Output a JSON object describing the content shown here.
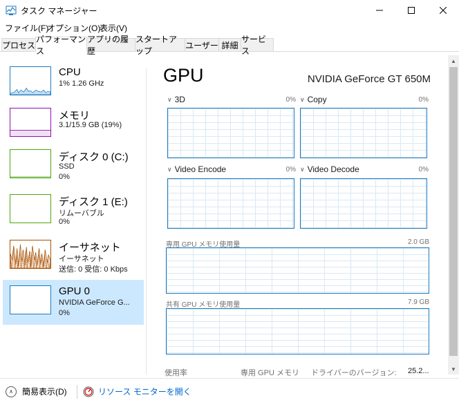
{
  "window": {
    "title": "タスク マネージャー",
    "minimize_icon": "minimize-icon",
    "maximize_icon": "maximize-icon",
    "close_icon": "close-icon"
  },
  "menu": [
    "ファイル(F)",
    "オプション(O)",
    "表示(V)"
  ],
  "tabs": [
    {
      "label": "プロセス",
      "active": false
    },
    {
      "label": "パフォーマンス",
      "active": true
    },
    {
      "label": "アプリの履歴",
      "active": false
    },
    {
      "label": "スタートアップ",
      "active": false
    },
    {
      "label": "ユーザー",
      "active": false
    },
    {
      "label": "詳細",
      "active": false
    },
    {
      "label": "サービス",
      "active": false
    }
  ],
  "sidebar": [
    {
      "name": "CPU",
      "line1": "1%  1.26 GHz",
      "line2": "",
      "color": "#1b7abf"
    },
    {
      "name": "メモリ",
      "line1": "3.1/15.9 GB (19%)",
      "line2": "",
      "color": "#8b12ae"
    },
    {
      "name": "ディスク 0 (C:)",
      "line1": "SSD",
      "line2": "0%",
      "color": "#4da60c"
    },
    {
      "name": "ディスク 1 (E:)",
      "line1": "リムーバブル",
      "line2": "0%",
      "color": "#4da60c"
    },
    {
      "name": "イーサネット",
      "line1": "イーサネット",
      "line2": "送信: 0 受信: 0 Kbps",
      "color": "#a74f01"
    },
    {
      "name": "GPU 0",
      "line1": "NVIDIA GeForce G...",
      "line2": "0%",
      "color": "#1b7abf",
      "selected": true
    }
  ],
  "main": {
    "title": "GPU",
    "device_name": "NVIDIA GeForce GT 650M",
    "engines": [
      {
        "label": "3D",
        "percent": "0%"
      },
      {
        "label": "Copy",
        "percent": "0%"
      },
      {
        "label": "Video Encode",
        "percent": "0%"
      },
      {
        "label": "Video Decode",
        "percent": "0%"
      }
    ],
    "dedicated_memory": {
      "label": "専用 GPU メモリ使用量",
      "max": "2.0 GB"
    },
    "shared_memory": {
      "label": "共有 GPU メモリ使用量",
      "max": "7.9 GB"
    },
    "stats": {
      "utilization_label": "使用率",
      "dedicated_label": "専用 GPU メモリ",
      "driver_label": "ドライバーのバージョン:",
      "driver_value": "25.2..."
    }
  },
  "bottom": {
    "fewer_details": "簡易表示(D)",
    "resource_monitor": "リソース モニターを開く"
  },
  "colors": {
    "accent": "#1b7abf",
    "selection": "#cce8ff",
    "link": "#0066cc"
  }
}
